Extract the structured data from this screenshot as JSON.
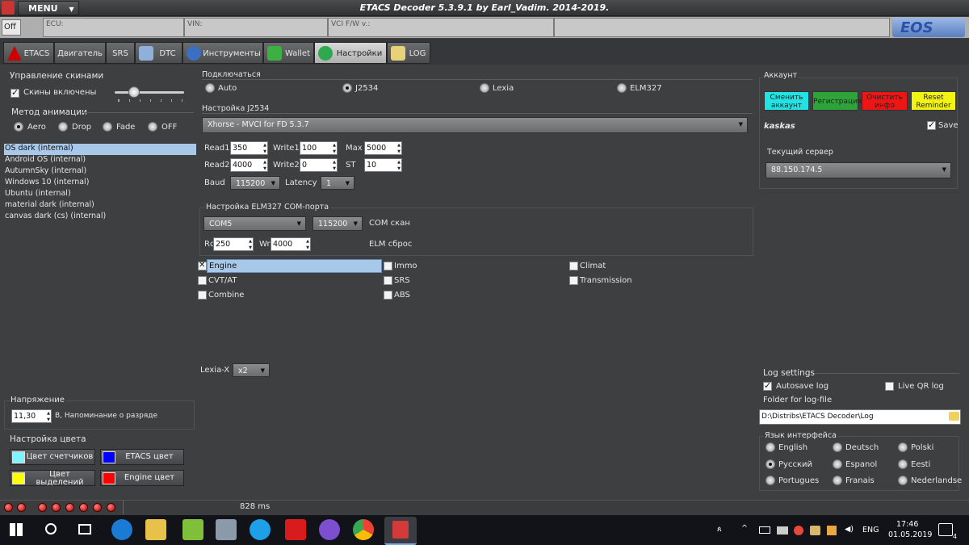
{
  "app": {
    "title": "ETACS Decoder 5.3.9.1 by Earl_Vadim. 2014-2019.",
    "menu_label": "MENU",
    "off_label": "Off",
    "logo_text": "EOS"
  },
  "info": {
    "ecu": "ECU:",
    "vin": "VIN:",
    "vci": "VCI F/W v.:"
  },
  "tabs": [
    {
      "label": "ETACS",
      "icon": "mitsubishi-icon"
    },
    {
      "label": "Двигатель",
      "icon": ""
    },
    {
      "label": "SRS",
      "icon": ""
    },
    {
      "label": "DTC",
      "icon": "magnifier-icon"
    },
    {
      "label": "Инструменты",
      "icon": "gear-icon"
    },
    {
      "label": "Wallet",
      "icon": "wallet-icon"
    },
    {
      "label": "Настройки",
      "icon": "settings-icon"
    },
    {
      "label": "LOG",
      "icon": "log-icon"
    }
  ],
  "skins": {
    "title": "Управление скинами",
    "enabled_label": "Скины включены",
    "animation_title": "Метод анимации",
    "animations": [
      "Aero",
      "Drop",
      "Fade",
      "OFF"
    ],
    "list": [
      "OS dark (internal)",
      "Android OS (internal)",
      "AutumnSky (internal)",
      "Windows 10 (internal)",
      "Ubuntu (internal)",
      "material dark (internal)",
      "canvas dark (cs) (internal)"
    ]
  },
  "voltage": {
    "title": "Напряжение",
    "value": "11,30",
    "suffix": "В, Напоминание о разряде"
  },
  "colors": {
    "title": "Настройка цвета",
    "buttons": [
      {
        "label": "Цвет счетчиков",
        "swatch": "#7ff3ff"
      },
      {
        "label": "ETACS цвет",
        "swatch": "#0000ff"
      },
      {
        "label": "Цвет выделений",
        "swatch": "#ffff00"
      },
      {
        "label": "Engine цвет",
        "swatch": "#ff0000"
      }
    ]
  },
  "connect": {
    "title": "Подключаться",
    "options": [
      "Auto",
      "J2534",
      "Lexia",
      "ELM327"
    ]
  },
  "j2534": {
    "title": "Настройка J2534",
    "device": "Xhorse - MVCI for FD 5.3.7",
    "read1_label": "Read1",
    "read1": "350",
    "write1_label": "Write1",
    "write1": "100",
    "max_label": "Max",
    "max": "5000",
    "read2_label": "Read2",
    "read2": "4000",
    "write2_label": "Write2",
    "write2": "0",
    "st_label": "ST",
    "st": "10",
    "baud_label": "Baud",
    "baud": "115200",
    "latency_label": "Latency",
    "latency": "1"
  },
  "elm": {
    "title": "Настройка ELM327 COM-порта",
    "port": "COM5",
    "baud": "115200",
    "com_scan": "COM скан",
    "rc_label": "Rc",
    "rc": "250",
    "wr_label": "Wr",
    "wr": "4000",
    "reset": "ELM сброс"
  },
  "modules": [
    "Engine",
    "Immo",
    "Climat",
    "CVT/AT",
    "SRS",
    "Transmission",
    "Combine",
    "ABS"
  ],
  "lexia": {
    "label": "Lexia-X",
    "value": "x2"
  },
  "account": {
    "title": "Аккаунт",
    "btn_change": "Сменить аккаунт",
    "btn_register": "Регистрация",
    "btn_clear": "Очистить инфо",
    "btn_reset": "Reset Reminder",
    "user": "kaskas",
    "save_label": "Save",
    "server_label": "Текущий сервер",
    "server": "88.150.174.5"
  },
  "log": {
    "title": "Log settings",
    "autosave": "Autosave log",
    "liveqr": "Live QR log",
    "folder_label": "Folder for log-file",
    "folder": "D:\\Distribs\\ETACS Decoder\\Log"
  },
  "lang": {
    "title": "Язык интерфейса",
    "items": [
      "English",
      "Deutsch",
      "Polski",
      "Русский",
      "Espanol",
      "Eesti",
      "Portugues",
      "Franais",
      "Nederlandse"
    ]
  },
  "status": {
    "ms": "828 ms"
  },
  "taskbar": {
    "lang": "ENG",
    "time": "17:46",
    "date": "01.05.2019",
    "notif": "4"
  }
}
